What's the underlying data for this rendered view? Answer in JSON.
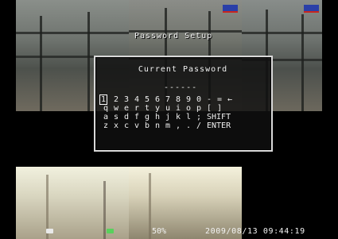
{
  "screen": {
    "title": "Password Setup"
  },
  "dialog": {
    "title": "Current Password",
    "mask": "------",
    "selected_key": "1"
  },
  "keyboard": {
    "rows": [
      [
        "1",
        "2",
        "3",
        "4",
        "5",
        "6",
        "7",
        "8",
        "9",
        "0",
        "-",
        "=",
        "←"
      ],
      [
        "q",
        "w",
        "e",
        "r",
        "t",
        "y",
        "u",
        "i",
        "o",
        "p",
        "[",
        "]"
      ],
      [
        "a",
        "s",
        "d",
        "f",
        "g",
        "h",
        "j",
        "k",
        "l",
        ";",
        "SHIFT"
      ],
      [
        "z",
        "x",
        "c",
        "v",
        "b",
        "n",
        "m",
        ",",
        ".",
        "/",
        "ENTER"
      ]
    ]
  },
  "status_bar": {
    "left": "50%",
    "datetime": "2009/08/13  09:44:19"
  },
  "icons": {
    "camera_icon_left": "camera-icon",
    "camera_icon_right": "camera-icon"
  }
}
